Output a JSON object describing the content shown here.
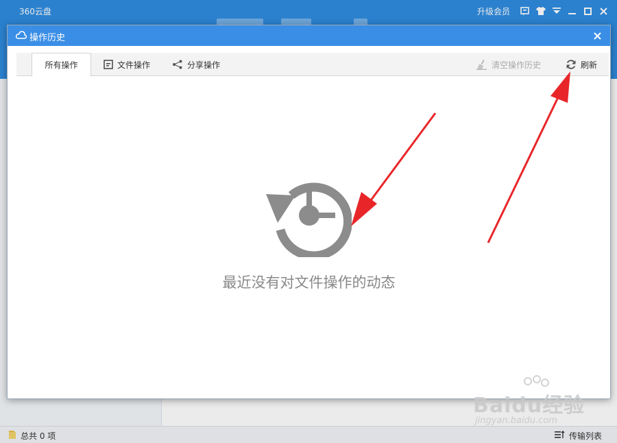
{
  "app": {
    "title": "360云盘",
    "upgrade_label": "升级会员"
  },
  "dialog": {
    "title": "操作历史",
    "tabs": [
      {
        "label": "所有操作"
      },
      {
        "label": "文件操作"
      },
      {
        "label": "分享操作"
      }
    ],
    "clear_label": "清空操作历史",
    "refresh_label": "刷新",
    "empty_message": "最近没有对文件操作的动态"
  },
  "statusbar": {
    "total_label": "总共 0 项",
    "transfer_label": "传输列表"
  },
  "watermark": {
    "text": "Baidu经验",
    "url": "jingyan.baidu.com"
  },
  "colors": {
    "titlebar": "#2f8ce0",
    "dialog_title": "#3a8ee6",
    "arrow": "#e8262a",
    "empty_icon": "#8c8c8c"
  }
}
